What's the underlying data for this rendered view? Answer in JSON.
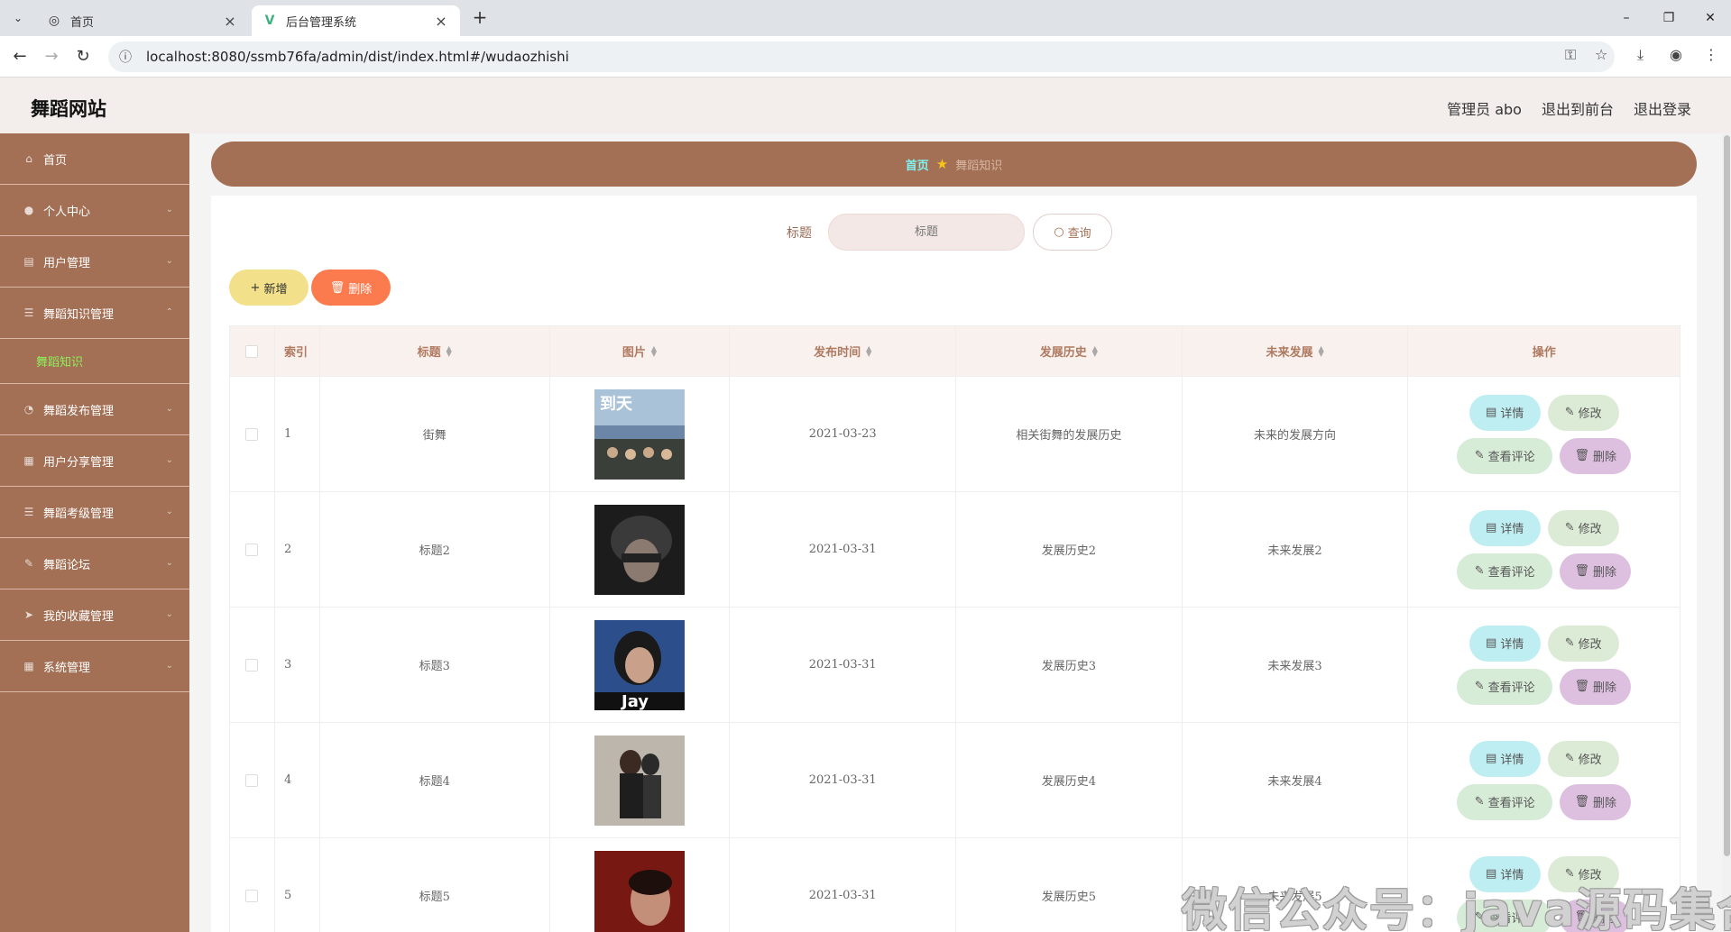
{
  "browser": {
    "tabs": [
      {
        "title": "首页",
        "icon": "globe-icon"
      },
      {
        "title": "后台管理系统",
        "icon": "vue-logo-icon"
      }
    ],
    "url": "localhost:8080/ssmb76fa/admin/dist/index.html#/wudaozhishi"
  },
  "header": {
    "brand": "舞蹈网站",
    "admin_label": "管理员 abo",
    "exit_front": "退出到前台",
    "logout": "退出登录"
  },
  "sidebar": {
    "items": [
      {
        "label": "首页",
        "icon": "home-icon"
      },
      {
        "label": "个人中心",
        "icon": "user-icon"
      },
      {
        "label": "用户管理",
        "icon": "users-icon"
      },
      {
        "label": "舞蹈知识管理",
        "icon": "list-icon"
      },
      {
        "label": "舞蹈发布管理",
        "icon": "compass-icon"
      },
      {
        "label": "用户分享管理",
        "icon": "document-icon"
      },
      {
        "label": "舞蹈考级管理",
        "icon": "list-icon"
      },
      {
        "label": "舞蹈论坛",
        "icon": "pencil-icon"
      },
      {
        "label": "我的收藏管理",
        "icon": "send-icon"
      },
      {
        "label": "系统管理",
        "icon": "grid-icon"
      }
    ],
    "submenu": "舞蹈知识"
  },
  "breadcrumb": {
    "home": "首页",
    "current": "舞蹈知识"
  },
  "search": {
    "label": "标题",
    "placeholder": "标题",
    "button": "查询"
  },
  "actions": {
    "add": "新增",
    "delete": "删除"
  },
  "table": {
    "headers": [
      "索引",
      "标题",
      "图片",
      "发布时间",
      "发展历史",
      "未来发展",
      "操作"
    ],
    "rows": [
      {
        "index": "1",
        "title": "街舞",
        "date": "2021-03-23",
        "history": "相关街舞的发展历史",
        "future": "未来的发展方向"
      },
      {
        "index": "2",
        "title": "标题2",
        "date": "2021-03-31",
        "history": "发展历史2",
        "future": "未来发展2"
      },
      {
        "index": "3",
        "title": "标题3",
        "date": "2021-03-31",
        "history": "发展历史3",
        "future": "未来发展3"
      },
      {
        "index": "4",
        "title": "标题4",
        "date": "2021-03-31",
        "history": "发展历史4",
        "future": "未来发展4"
      },
      {
        "index": "5",
        "title": "标题5",
        "date": "2021-03-31",
        "history": "发展历史5",
        "future": "未来发展5"
      }
    ],
    "op_labels": {
      "detail": "详情",
      "edit": "修改",
      "comment": "查看评论",
      "remove": "删除"
    }
  },
  "watermark": "微信公众号：java源码集合",
  "colors": {
    "primary": "#a37055",
    "header_bg": "#f3eeec",
    "add": "#f3e08a",
    "delete": "#fb7b4e",
    "detail": "#bfeef2",
    "edit": "#dcebd6",
    "remove": "#ddbfe0"
  }
}
